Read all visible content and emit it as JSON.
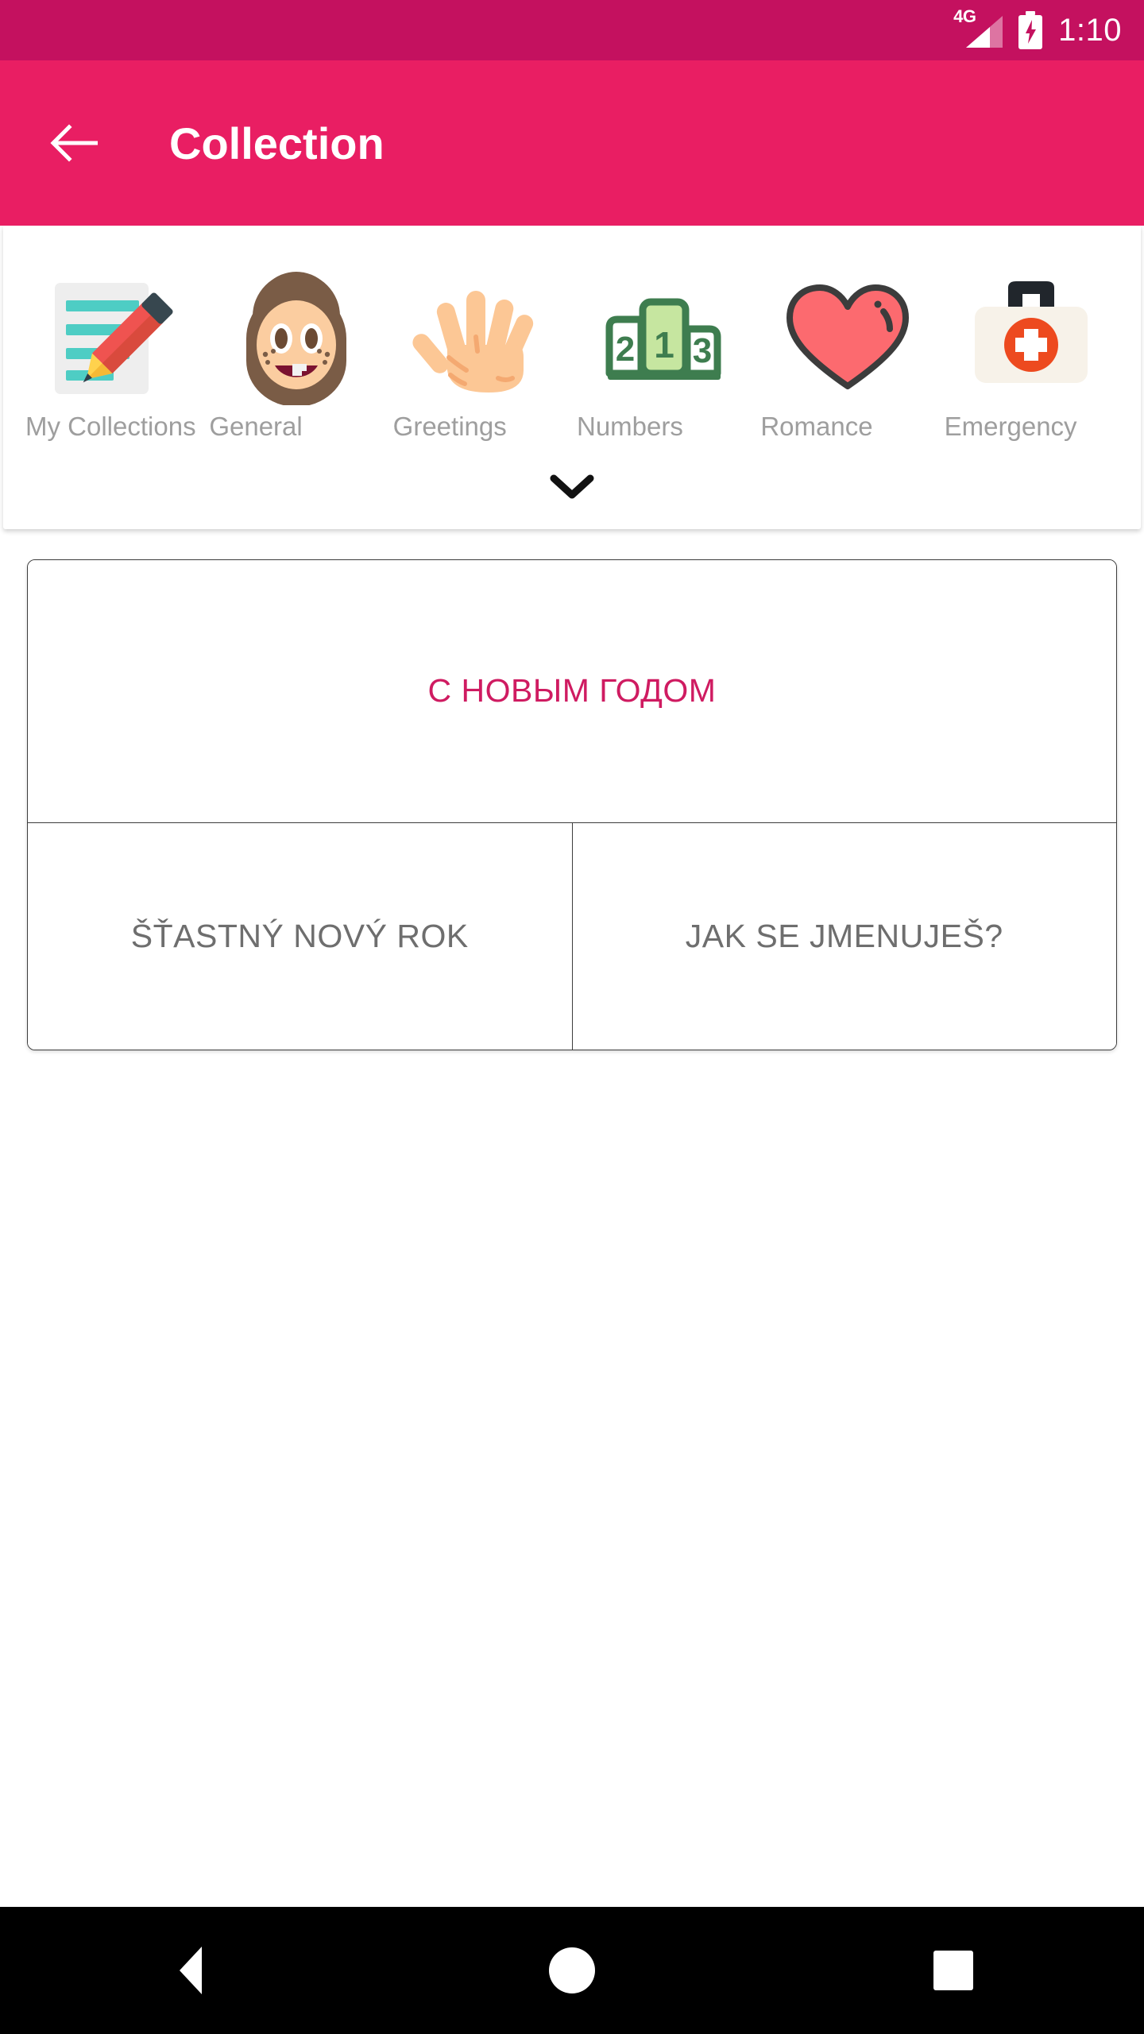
{
  "status_bar": {
    "network_type": "4G",
    "time": "1:10",
    "battery_state": "charging",
    "background_color": "#c4115f",
    "icons": [
      "signal-icon",
      "battery-charging-icon"
    ]
  },
  "app_bar": {
    "title": "Collection",
    "back_icon": "arrow-left-icon",
    "background_color": "#e91e63"
  },
  "categories": {
    "items": [
      {
        "label": "My Collections",
        "icon": "note-pencil-icon"
      },
      {
        "label": "General",
        "icon": "girl-face-icon"
      },
      {
        "label": "Greetings",
        "icon": "open-hand-icon"
      },
      {
        "label": "Numbers",
        "icon": "podium-icon"
      },
      {
        "label": "Romance",
        "icon": "heart-icon"
      },
      {
        "label": "Emergency",
        "icon": "first-aid-kit-icon"
      }
    ],
    "expand_icon": "chevron-down-icon",
    "label_color": "#9e9e9e"
  },
  "phrases": {
    "rows": [
      [
        {
          "text": "С НОВЫМ ГОДОМ",
          "accent": true
        }
      ],
      [
        {
          "text": "ŠŤASTNÝ NOVÝ ROK",
          "accent": false
        },
        {
          "text": "JAK SE JMENUJEŠ?",
          "accent": false
        }
      ]
    ],
    "accent_color": "#cf1b61",
    "text_color": "#6e6e6e"
  },
  "nav_bar": {
    "back_label": "Back",
    "home_label": "Home",
    "recents_label": "Recents",
    "background_color": "#000000"
  }
}
